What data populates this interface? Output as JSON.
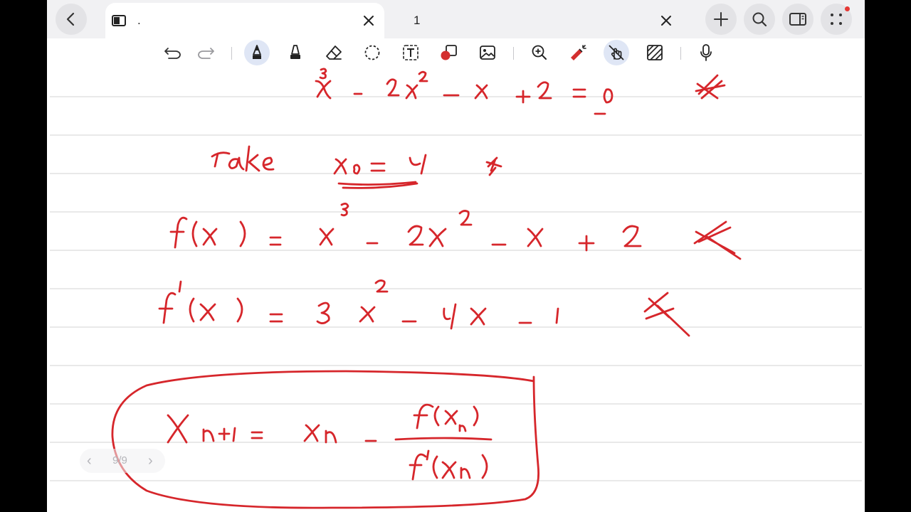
{
  "tabs": [
    {
      "title": ".",
      "active": true
    },
    {
      "title": "1",
      "active": false
    }
  ],
  "icons": {
    "back": "chevron-left-icon",
    "new_tab": "plus-icon",
    "search": "search-icon",
    "sidebar": "sidebar-icon",
    "more": "grid-dots-icon"
  },
  "toolbar": {
    "tools": [
      "undo",
      "redo",
      "pen",
      "highlighter",
      "eraser",
      "lasso",
      "text-box",
      "shapes",
      "image",
      "zoom",
      "laser-pointer",
      "touch-draw",
      "ruled-lines",
      "microphone"
    ],
    "active_tools": [
      "pen",
      "touch-draw"
    ]
  },
  "colors": {
    "ink": "#d6262b",
    "page_lines": "#dcdcdc",
    "tab_bar": "#f1f1f3",
    "active_tool_bg": "#dfe6f5",
    "notification_dot": "#e53935"
  },
  "pager": {
    "current_page": "9/9"
  }
}
